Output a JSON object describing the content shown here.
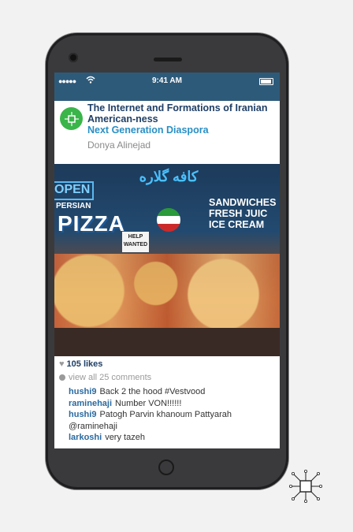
{
  "status_bar": {
    "signal": "●●●●●",
    "time": "9:41 AM"
  },
  "post": {
    "title": "The Internet and Formations of Iranian American-ness",
    "subtitle": "Next Generation Diaspora",
    "author": "Donya Alinejad"
  },
  "photo_signs": {
    "open": "OPEN",
    "cafe": "کافه گلاره",
    "persian": "PERSIAN",
    "pizza": "PIZZA",
    "right": "SANDWICHES FRESH JUIC ICE CREAM",
    "help": "HELP WANTED"
  },
  "engagement": {
    "likes": "105 likes",
    "view_comments": "view all 25 comments"
  },
  "comments": [
    {
      "user": "hushi9",
      "text": "Back 2 the hood #Vestvood"
    },
    {
      "user": "raminehaji",
      "text": "Number VON!!!!!!"
    },
    {
      "user": "hushi9",
      "text": "Patogh Parvin khanoum Pattyarah @raminehaji"
    },
    {
      "user": "larkoshi",
      "text": "very tazeh"
    }
  ],
  "colors": {
    "status_bar": "#2e5a7a",
    "title": "#1f3f66",
    "subtitle": "#2a8fc4",
    "username": "#2a6aa0",
    "logo": "#3ab54a"
  }
}
